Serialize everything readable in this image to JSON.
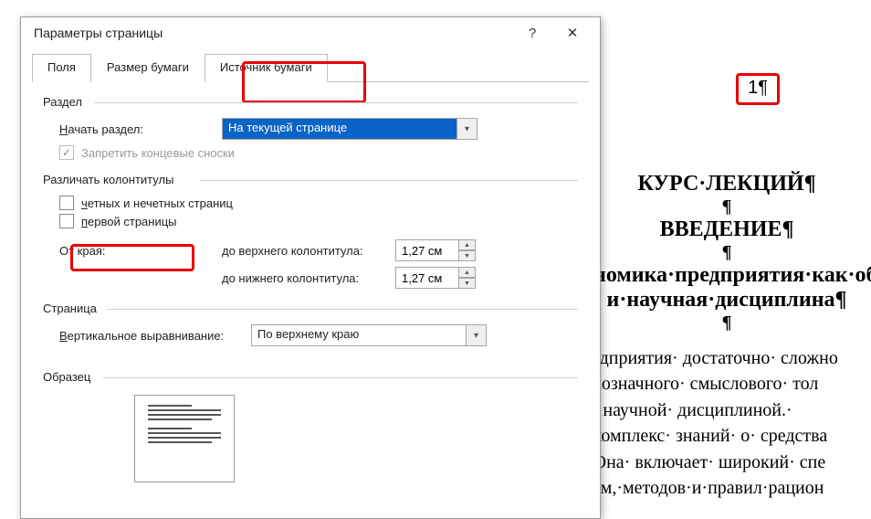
{
  "dialog": {
    "title": "Параметры страницы",
    "help": "?",
    "close": "✕",
    "tabs": {
      "fields": "Поля",
      "paper": "Размер бумаги",
      "source": "Источник бумаги"
    },
    "section": {
      "header": "Раздел",
      "start_label": "Начать раздел:",
      "start_value": "На текущей странице",
      "suppress_endnotes": "Запретить концевые сноски"
    },
    "headers_footers": {
      "header": "Различать колонтитулы",
      "odd_even": "четных и нечетных страниц",
      "first_page": "первой страницы",
      "from_edge": "От края:",
      "to_header": "до верхнего колонтитула:",
      "to_footer": "до нижнего колонтитула:",
      "header_val": "1,27 см",
      "footer_val": "1,27 см"
    },
    "page": {
      "header": "Страница",
      "valign_label": "Вертикальное выравнивание:",
      "valign_value": "По верхнему краю"
    },
    "sample": {
      "header": "Образец"
    }
  },
  "document": {
    "page_number": "1¶",
    "lines": [
      "КУРС·ЛЕКЦИЙ¶",
      "¶",
      "ВВЕДЕНИЕ¶",
      "¶",
      "ономика·предприятия·как·обр",
      "и·научная·дисциплина¶",
      "¶"
    ],
    "body": [
      "редприятия· достаточно· сложно",
      "днозначного· смыслового· тол",
      "и· научной· дисциплиной.· ",
      "· комплекс· знаний· о· средства",
      "· Она· включает· широкий· спе",
      "орм,·методов·и·правил·рацион"
    ]
  }
}
